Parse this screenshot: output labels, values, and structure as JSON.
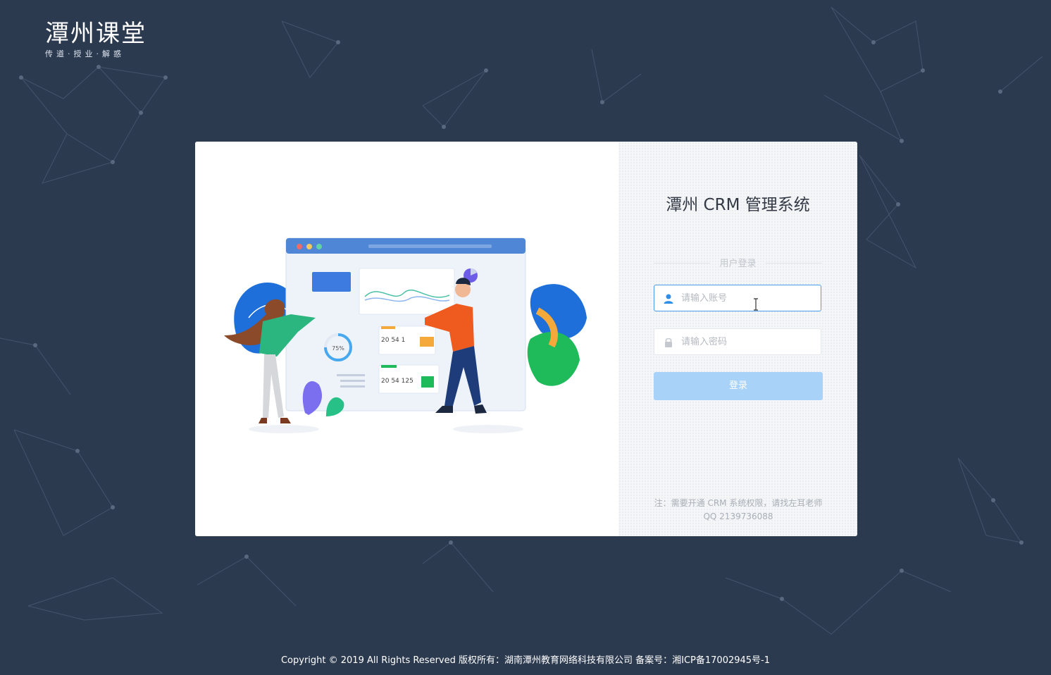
{
  "brand": {
    "logo_text": "潭州课堂",
    "slogan": "传道·授业·解惑"
  },
  "login": {
    "title": "潭州 CRM 管理系统",
    "tab_label": "用户登录",
    "username_placeholder": "请输入账号",
    "password_placeholder": "请输入密码",
    "submit_label": "登录",
    "note": "注：需要开通 CRM 系统权限，请找左耳老师 QQ 2139736088"
  },
  "illustration": {
    "widget_value_1": "20 54 1",
    "widget_value_2": "20 54 125",
    "gauge_label": "75%"
  },
  "footer": {
    "text": "Copyright © 2019 All Rights Reserved 版权所有：湖南潭州教育网络科技有限公司 备案号：湘ICP备17002945号-1"
  },
  "colors": {
    "background": "#2c3a50",
    "accent": "#4a9be8",
    "button": "#a8d2f7"
  }
}
